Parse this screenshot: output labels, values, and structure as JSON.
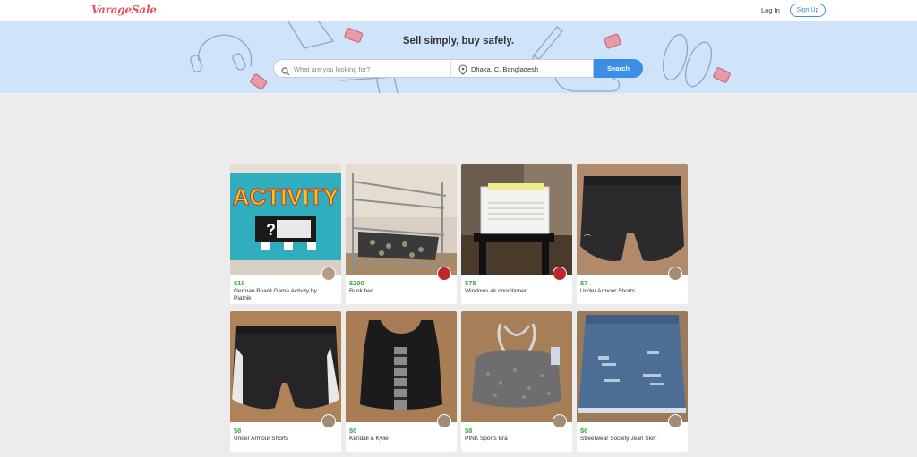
{
  "header": {
    "logo": "VarageSale",
    "login_label": "Log In",
    "signup_label": "Sign Up"
  },
  "hero": {
    "tagline": "Sell simply, buy safely.",
    "search_placeholder": "What are you looking for?",
    "location": "Dhaka, C, Bangladesh",
    "search_button": "Search"
  },
  "listings": [
    {
      "price": "$10",
      "title": "German Board Game Activity by Piatnik"
    },
    {
      "price": "$200",
      "title": "Bunk bed"
    },
    {
      "price": "$75",
      "title": "Windows air conditioner"
    },
    {
      "price": "$7",
      "title": "Under Armour Shorts"
    },
    {
      "price": "$8",
      "title": "Under Armour Shorts"
    },
    {
      "price": "$6",
      "title": "Kendall & Kylie"
    },
    {
      "price": "$8",
      "title": "PINK Sports Bra"
    },
    {
      "price": "$6",
      "title": "Streetwear Society Jean Skirt"
    }
  ],
  "icons": {
    "search": "search-icon",
    "location": "location-pin-icon"
  },
  "colors": {
    "brand": "#e8505b",
    "accent": "#3a8ee6",
    "price": "#3aa844",
    "hero_bg": "#cfe3fb"
  }
}
